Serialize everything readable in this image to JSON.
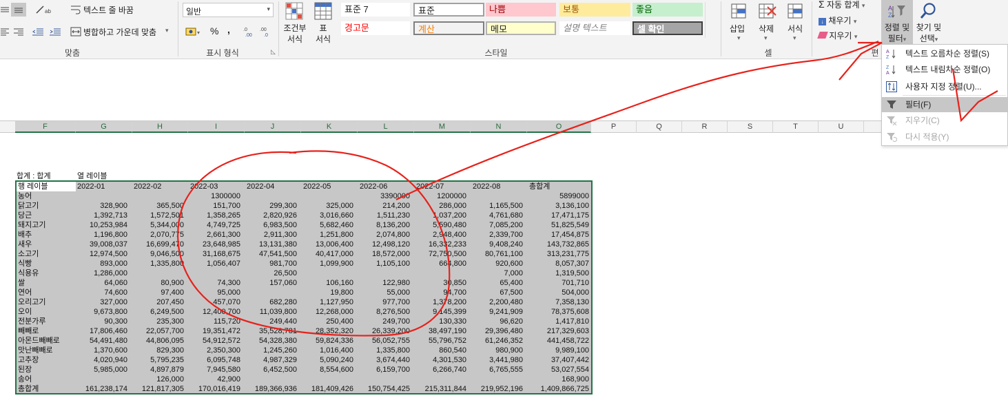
{
  "ribbon": {
    "wrap_text": "텍스트 줄 바꿈",
    "merge_center": "병합하고 가운데 맞춤",
    "number_format": "일반",
    "percent": "%",
    "comma": ",",
    "group_align": "맞춤",
    "group_number": "표시 형식",
    "cond_format": [
      "조건부",
      "서식"
    ],
    "table_format": [
      "표",
      "서식"
    ],
    "group_styles": "스타일",
    "styles": [
      {
        "label": "표준 7",
        "bg": "#ffffff",
        "color": "#222222",
        "border": "none"
      },
      {
        "label": "표준",
        "bg": "#ffffff",
        "color": "#222222",
        "border": "#a0a0a0"
      },
      {
        "label": "나쁨",
        "bg": "#ffc7ce",
        "color": "#9c0006",
        "border": "none"
      },
      {
        "label": "보통",
        "bg": "#ffeb9c",
        "color": "#9c5700",
        "border": "none"
      },
      {
        "label": "좋음",
        "bg": "#c6efce",
        "color": "#006100",
        "border": "none"
      },
      {
        "label": "경고문",
        "bg": "#ffffff",
        "color": "#ff0000",
        "border": "none"
      },
      {
        "label": "계산",
        "bg": "#f2f2f2",
        "color": "#fa7d00",
        "border": "#7f7f7f"
      },
      {
        "label": "메모",
        "bg": "#ffffcc",
        "color": "#222222",
        "border": "#b2b2b2"
      },
      {
        "label": "설명 텍스트",
        "bg": "#ffffff",
        "color": "#7f7f7f",
        "border": "none"
      },
      {
        "label": "셀 확인",
        "bg": "#a5a5a5",
        "color": "#ffffff",
        "border": "#3f3f3f"
      }
    ],
    "insert": "삽입",
    "delete": "삭제",
    "format": "서식",
    "group_cells": "셀",
    "autosum": "자동 합계",
    "fill": "채우기",
    "clear": "지우기",
    "group_edit": "편",
    "sort_filter": [
      "정렬 및",
      "필터"
    ],
    "find_select": [
      "찾기 및",
      "선택"
    ]
  },
  "columns": [
    "F",
    "G",
    "H",
    "I",
    "J",
    "K",
    "L",
    "M",
    "N",
    "O",
    "P",
    "Q",
    "R",
    "S",
    "T",
    "U"
  ],
  "menu": {
    "items": [
      {
        "label": "텍스트 오름차순 정렬(S)",
        "icon": "sort-ascending-icon",
        "disabled": false,
        "highlight": false
      },
      {
        "label": "텍스트 내림차순 정렬(O)",
        "icon": "sort-descending-icon",
        "disabled": false,
        "highlight": false
      },
      {
        "label": "사용자 지정 정렬(U)...",
        "icon": "custom-sort-icon",
        "disabled": false,
        "highlight": false
      },
      {
        "label": "필터(F)",
        "icon": "filter-icon",
        "disabled": false,
        "highlight": true
      },
      {
        "label": "지우기(C)",
        "icon": "clear-filter-icon",
        "disabled": true,
        "highlight": false
      },
      {
        "label": "다시 적용(Y)",
        "icon": "reapply-icon",
        "disabled": true,
        "highlight": false
      }
    ]
  },
  "pivot": {
    "caption_sum": "합계 : 합계",
    "caption_col": "열 레이블",
    "row_label": "행 레이블",
    "headers": [
      "2022-01",
      "2022-02",
      "2022-03",
      "2022-04",
      "2022-05",
      "2022-06",
      "2022-07",
      "2022-08",
      "총합계"
    ],
    "rows": [
      [
        "농어",
        "",
        "",
        "1300000",
        "",
        "",
        "3390000",
        "1200000",
        "",
        "5899000"
      ],
      [
        "닭고기",
        "328,900",
        "365,500",
        "151,700",
        "299,300",
        "325,000",
        "214,200",
        "286,000",
        "1,165,500",
        "3,136,100"
      ],
      [
        "당근",
        "1,392,713",
        "1,572,501",
        "1,358,265",
        "2,820,926",
        "3,016,660",
        "1,511,230",
        "1,037,200",
        "4,761,680",
        "17,471,175"
      ],
      [
        "돼지고기",
        "10,253,984",
        "5,344,000",
        "4,749,725",
        "6,983,500",
        "5,682,460",
        "8,136,200",
        "5,590,480",
        "7,085,200",
        "51,825,549"
      ],
      [
        "배추",
        "1,196,800",
        "2,070,775",
        "2,661,300",
        "2,911,300",
        "1,251,800",
        "2,074,800",
        "2,948,400",
        "2,339,700",
        "17,454,875"
      ],
      [
        "새우",
        "39,008,037",
        "16,699,470",
        "23,648,985",
        "13,131,380",
        "13,006,400",
        "12,498,120",
        "16,332,233",
        "9,408,240",
        "143,732,865"
      ],
      [
        "소고기",
        "12,974,500",
        "9,046,500",
        "31,168,675",
        "47,541,500",
        "40,417,000",
        "18,572,000",
        "72,750,500",
        "80,761,100",
        "313,231,775"
      ],
      [
        "식빵",
        "893,000",
        "1,335,800",
        "1,056,407",
        "981,700",
        "1,099,900",
        "1,105,100",
        "664,800",
        "920,600",
        "8,057,307"
      ],
      [
        "식용유",
        "1,286,000",
        "",
        "",
        "26,500",
        "",
        "",
        "",
        "7,000",
        "1,319,500"
      ],
      [
        "쌀",
        "64,060",
        "80,900",
        "74,300",
        "157,060",
        "106,160",
        "122,980",
        "30,850",
        "65,400",
        "701,710"
      ],
      [
        "연어",
        "74,600",
        "97,400",
        "95,000",
        "",
        "19,800",
        "55,000",
        "94,700",
        "67,500",
        "504,000"
      ],
      [
        "오리고기",
        "327,000",
        "207,450",
        "457,070",
        "682,280",
        "1,127,950",
        "977,700",
        "1,378,200",
        "2,200,480",
        "7,358,130"
      ],
      [
        "오이",
        "9,673,800",
        "6,249,500",
        "12,400,700",
        "11,039,800",
        "12,268,000",
        "8,276,500",
        "9,145,399",
        "9,241,909",
        "78,375,608"
      ],
      [
        "전분가루",
        "90,300",
        "235,300",
        "115,720",
        "249,440",
        "250,400",
        "249,700",
        "130,330",
        "96,620",
        "1,417,810"
      ],
      [
        "빼빼로",
        "17,806,460",
        "22,057,700",
        "19,351,472",
        "35,528,781",
        "28,352,320",
        "26,339,200",
        "38,497,190",
        "29,396,480",
        "217,329,603"
      ],
      [
        "아몬드빼빼로",
        "54,491,480",
        "44,806,095",
        "54,912,572",
        "54,328,380",
        "59,824,336",
        "56,052,755",
        "55,796,752",
        "61,246,352",
        "441,458,722"
      ],
      [
        "맛난빼빼로",
        "1,370,600",
        "829,300",
        "2,350,300",
        "1,245,260",
        "1,016,400",
        "1,335,800",
        "860,540",
        "980,900",
        "9,989,100"
      ],
      [
        "고추장",
        "4,020,940",
        "5,795,235",
        "6,095,748",
        "4,987,329",
        "5,090,240",
        "3,674,440",
        "4,301,530",
        "3,441,980",
        "37,407,442"
      ],
      [
        "된장",
        "5,985,000",
        "4,897,879",
        "7,945,580",
        "6,452,500",
        "8,554,600",
        "6,159,700",
        "6,266,740",
        "6,765,555",
        "53,027,554"
      ],
      [
        "송어",
        "",
        "126,000",
        "42,900",
        "",
        "",
        "",
        "",
        "",
        "168,900"
      ],
      [
        "총합계",
        "161,238,174",
        "121,817,305",
        "170,016,419",
        "189,366,936",
        "181,409,426",
        "150,754,425",
        "215,311,844",
        "219,952,196",
        "1,409,866,725"
      ]
    ]
  }
}
